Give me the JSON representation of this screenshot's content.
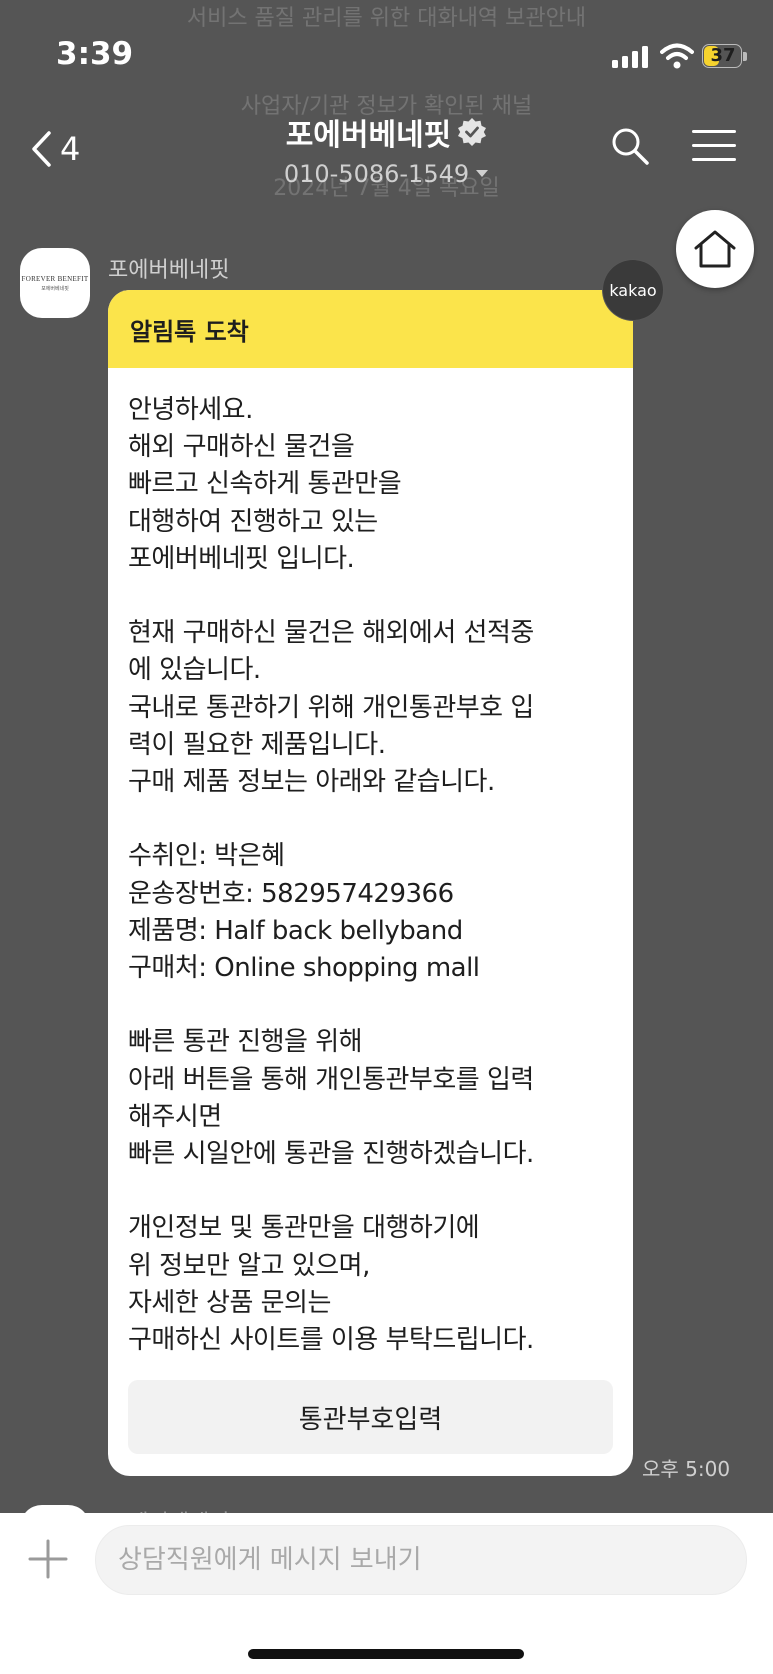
{
  "background_overlay": {
    "notice_top": "서비스 품질 관리를 위한 대화내역 보관안내",
    "verified_notice": "사업자/기관 정보가 확인된 채널",
    "date_divider": "2024년 7월 4일 목요일"
  },
  "status_bar": {
    "time": "3:39",
    "battery": "37"
  },
  "header": {
    "back_count": "4",
    "channel_name": "포에버베네핏",
    "phone": "010-5086-1549"
  },
  "message": {
    "sender": "포에버베네핏",
    "avatar_logo": "FOREVER BENEFIT",
    "avatar_logo_sub": "포에버베네핏",
    "header": "알림톡 도착",
    "body": "안녕하세요.\n해외 구매하신 물건을\n빠르고 신속하게 통관만을\n대행하여 진행하고 있는\n포에버베네핏 입니다.\n\n현재 구매하신 물건은 해외에서 선적중\n에 있습니다.\n국내로 통관하기 위해 개인통관부호 입\n력이 필요한 제품입니다.\n구매 제품 정보는 아래와 같습니다.\n\n수취인: 박은혜\n운송장번호: 582957429366\n제품명: Half back bellyband\n구매처: Online shopping mall\n\n빠른 통관 진행을 위해\n아래 버튼을 통해 개인통관부호를 입력\n해주시면\n빠른 시일안에 통관을 진행하겠습니다.\n\n개인정보 및 통관만을 대행하기에\n위 정보만 알고 있으며,\n자세한 상품 문의는\n구매하신 사이트를 이용 부탁드립니다.",
    "button_label": "통관부호입력",
    "badge": "kakao",
    "time": "오후 5:00"
  },
  "next_message": {
    "sender": "포에버베네핏"
  },
  "input": {
    "placeholder": "상담직원에게 메시지 보내기"
  },
  "colors": {
    "background": "#555555",
    "bubble_header": "#fbe44b",
    "battery": "#f6d32e"
  },
  "icons": [
    "back-chevron-icon",
    "verified-badge-icon",
    "dropdown-caret-icon",
    "search-icon",
    "menu-icon",
    "home-icon",
    "plus-icon",
    "signal-icon",
    "wifi-icon"
  ]
}
